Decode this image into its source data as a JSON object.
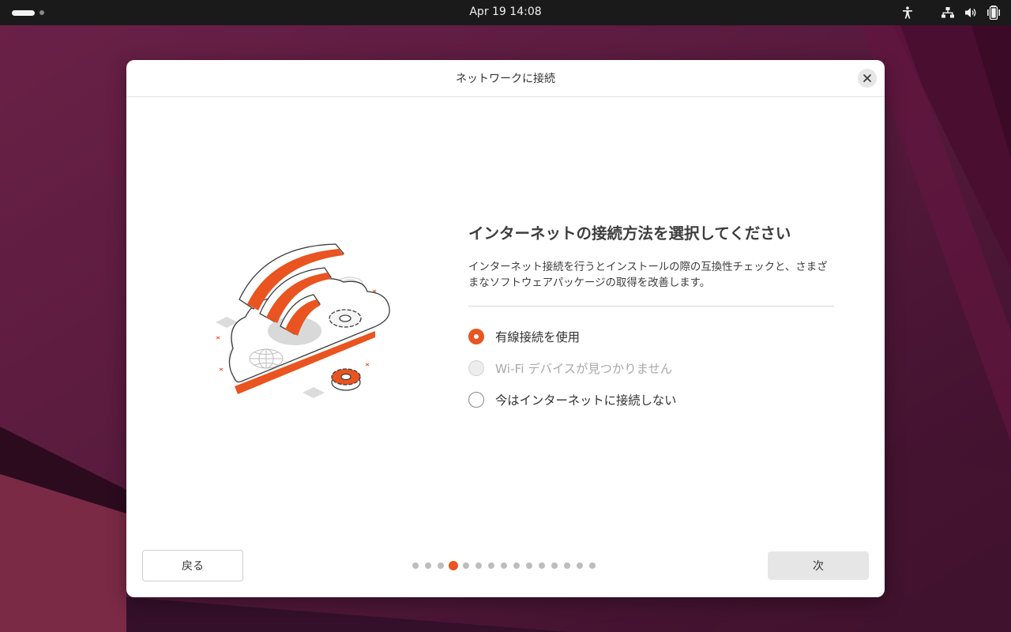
{
  "topbar": {
    "clock": "Apr 19  14:08",
    "tray_icons": [
      "accessibility-icon",
      "network-wired-icon",
      "volume-icon",
      "battery-icon"
    ]
  },
  "dialog": {
    "title": "ネットワークに接続",
    "close_icon": "close-icon"
  },
  "main": {
    "heading": "インターネットの接続方法を選択してください",
    "description": "インターネット接続を行うとインストールの際の互換性チェックと、さまざまなソフトウェアパッケージの取得を改善します。",
    "options": [
      {
        "label": "有線接続を使用",
        "state": "checked"
      },
      {
        "label": "Wi-Fi デバイスが見つかりません",
        "state": "disabled"
      },
      {
        "label": "今はインターネットに接続しない",
        "state": "unchecked"
      }
    ]
  },
  "footer": {
    "back_label": "戻る",
    "next_label": "次",
    "pager": {
      "total": 15,
      "current": 4
    }
  },
  "colors": {
    "accent": "#e95420",
    "topbar": "#1a1a1a",
    "wallpaper": "#5a1a3e"
  }
}
